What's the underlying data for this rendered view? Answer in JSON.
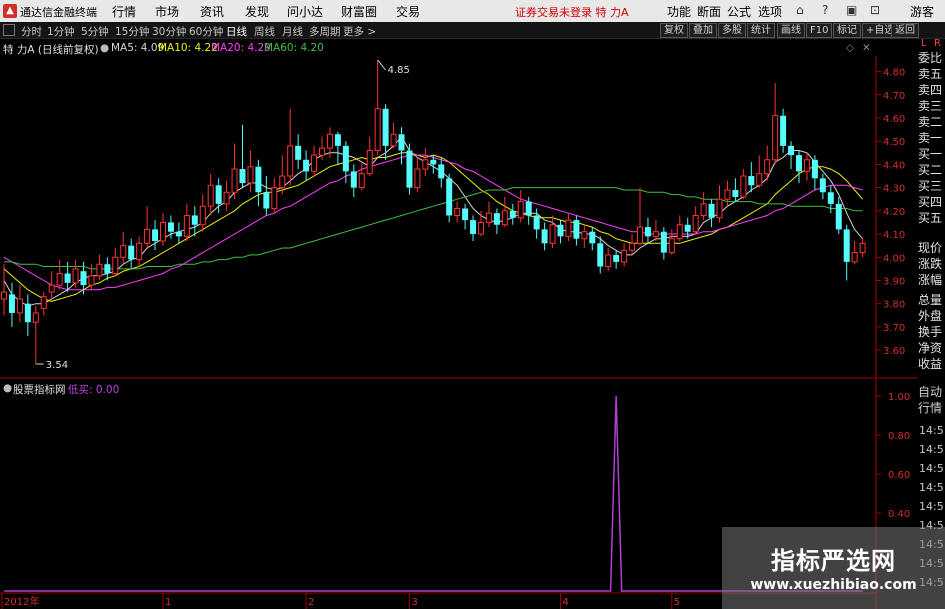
{
  "menubar": {
    "app_title": "通达信金融终端",
    "items": [
      "行情",
      "市场",
      "资讯",
      "发现",
      "问小达",
      "财富圈",
      "交易"
    ],
    "warning": "证券交易未登录  特 力A",
    "right_items": [
      "功能",
      "断面",
      "公式",
      "选项"
    ],
    "window_buttons": [
      "⌂",
      "?",
      "▣",
      "⊡"
    ],
    "guest": "游客"
  },
  "toolbar": {
    "periods": [
      "分时",
      "1分钟",
      "5分钟",
      "15分钟",
      "30分钟",
      "60分钟",
      "日线",
      "周线",
      "月线",
      "多周期",
      "更多 >"
    ],
    "buttons": [
      "复权",
      "叠加",
      "多股",
      "统计",
      "画线",
      "F10",
      "标记",
      "+自选",
      "返回"
    ]
  },
  "kline": {
    "stock": "特 力A (日线前复权)",
    "ma5": "MA5: 4.09",
    "ma10": "MA10: 4.22",
    "ma20": "MA20: 4.29",
    "ma60": "MA60: 4.20",
    "high_label": "4.85",
    "low_label": "3.54",
    "price_ticks": [
      "4.80",
      "4.70",
      "4.60",
      "4.50",
      "4.40",
      "4.30",
      "4.20",
      "4.10",
      "4.00",
      "3.90",
      "3.80",
      "3.70",
      "3.60"
    ]
  },
  "indicator": {
    "source": "股票指标网",
    "label": "低买: 0.00",
    "ticks": [
      "1.00",
      "0.80",
      "0.60",
      "0.40"
    ]
  },
  "time_axis": [
    "2012年",
    "1",
    "2",
    "3",
    "4",
    "5"
  ],
  "sidebar": {
    "top": [
      "L",
      "R"
    ],
    "fields": [
      "委比",
      "卖五",
      "卖四",
      "卖三",
      "卖二",
      "卖一",
      "买一",
      "买二",
      "买三",
      "买四",
      "买五",
      "现价",
      "涨跌",
      "涨幅",
      "总量",
      "外盘",
      "换手",
      "净资",
      "收益",
      "自动",
      "行情"
    ],
    "times": [
      "14:5",
      "14:5",
      "14:5",
      "14:5",
      "14:5",
      "14:5",
      "14:5",
      "14:5",
      "14:5"
    ]
  },
  "watermark": {
    "title": "指标严选网",
    "url": "www.xuezhibiao.com"
  },
  "colors": {
    "up": "#ff3232",
    "down": "#54fcfc",
    "ma5": "#d8d8d8",
    "ma10": "#f0f000",
    "ma20": "#ff40ff",
    "ma60": "#40c040",
    "indicator": "#b040d0"
  },
  "chart_data": {
    "type": "candlestick",
    "y_range": [
      3.54,
      4.85
    ],
    "candles": [
      [
        3.82,
        3.85,
        3.97,
        3.75
      ],
      [
        3.84,
        3.76,
        3.89,
        3.7
      ],
      [
        3.76,
        3.82,
        3.88,
        3.72
      ],
      [
        3.8,
        3.72,
        3.84,
        3.66
      ],
      [
        3.72,
        3.76,
        3.79,
        3.54
      ],
      [
        3.78,
        3.83,
        3.85,
        3.75
      ],
      [
        3.85,
        3.88,
        3.94,
        3.82
      ],
      [
        3.88,
        3.93,
        3.99,
        3.86
      ],
      [
        3.93,
        3.89,
        3.98,
        3.85
      ],
      [
        3.89,
        3.95,
        3.99,
        3.87
      ],
      [
        3.94,
        3.88,
        3.98,
        3.84
      ],
      [
        3.88,
        3.92,
        3.97,
        3.86
      ],
      [
        3.92,
        3.97,
        4.01,
        3.9
      ],
      [
        3.97,
        3.93,
        4.0,
        3.9
      ],
      [
        3.93,
        4.0,
        4.04,
        3.92
      ],
      [
        4.0,
        4.05,
        4.11,
        3.97
      ],
      [
        4.05,
        3.99,
        4.08,
        3.95
      ],
      [
        3.99,
        4.06,
        4.09,
        3.96
      ],
      [
        4.06,
        4.12,
        4.22,
        4.04
      ],
      [
        4.12,
        4.07,
        4.16,
        4.03
      ],
      [
        4.07,
        4.15,
        4.19,
        4.05
      ],
      [
        4.15,
        4.11,
        4.18,
        4.08
      ],
      [
        4.11,
        4.09,
        4.15,
        4.06
      ],
      [
        4.09,
        4.18,
        4.23,
        4.07
      ],
      [
        4.18,
        4.14,
        4.22,
        4.09
      ],
      [
        4.14,
        4.22,
        4.27,
        4.11
      ],
      [
        4.22,
        4.31,
        4.36,
        4.18
      ],
      [
        4.31,
        4.23,
        4.34,
        4.19
      ],
      [
        4.23,
        4.28,
        4.33,
        4.2
      ],
      [
        4.28,
        4.38,
        4.49,
        4.25
      ],
      [
        4.38,
        4.32,
        4.57,
        4.3
      ],
      [
        4.32,
        4.39,
        4.46,
        4.28
      ],
      [
        4.39,
        4.28,
        4.42,
        4.22
      ],
      [
        4.28,
        4.21,
        4.35,
        4.18
      ],
      [
        4.21,
        4.3,
        4.34,
        4.19
      ],
      [
        4.3,
        4.35,
        4.44,
        4.27
      ],
      [
        4.35,
        4.48,
        4.64,
        4.31
      ],
      [
        4.48,
        4.42,
        4.53,
        4.38
      ],
      [
        4.42,
        4.37,
        4.46,
        4.33
      ],
      [
        4.37,
        4.44,
        4.48,
        4.35
      ],
      [
        4.44,
        4.47,
        4.52,
        4.42
      ],
      [
        4.47,
        4.53,
        4.56,
        4.43
      ],
      [
        4.53,
        4.48,
        4.54,
        4.4
      ],
      [
        4.48,
        4.37,
        4.5,
        4.32
      ],
      [
        4.37,
        4.3,
        4.4,
        4.26
      ],
      [
        4.3,
        4.36,
        4.41,
        4.29
      ],
      [
        4.36,
        4.46,
        4.52,
        4.35
      ],
      [
        4.46,
        4.64,
        4.85,
        4.44
      ],
      [
        4.64,
        4.48,
        4.66,
        4.42
      ],
      [
        4.48,
        4.53,
        4.58,
        4.47
      ],
      [
        4.53,
        4.46,
        4.56,
        4.4
      ],
      [
        4.46,
        4.3,
        4.49,
        4.27
      ],
      [
        4.3,
        4.38,
        4.43,
        4.28
      ],
      [
        4.38,
        4.42,
        4.47,
        4.35
      ],
      [
        4.42,
        4.4,
        4.44,
        4.36
      ],
      [
        4.4,
        4.34,
        4.43,
        4.3
      ],
      [
        4.34,
        4.18,
        4.36,
        4.15
      ],
      [
        4.18,
        4.21,
        4.24,
        4.15
      ],
      [
        4.21,
        4.16,
        4.23,
        4.12
      ],
      [
        4.16,
        4.1,
        4.18,
        4.07
      ],
      [
        4.1,
        4.15,
        4.2,
        4.09
      ],
      [
        4.15,
        4.19,
        4.24,
        4.13
      ],
      [
        4.19,
        4.14,
        4.21,
        4.1
      ],
      [
        4.14,
        4.2,
        4.26,
        4.13
      ],
      [
        4.2,
        4.17,
        4.23,
        4.14
      ],
      [
        4.17,
        4.24,
        4.29,
        4.15
      ],
      [
        4.24,
        4.18,
        4.26,
        4.14
      ],
      [
        4.18,
        4.12,
        4.21,
        4.08
      ],
      [
        4.12,
        4.06,
        4.15,
        4.03
      ],
      [
        4.06,
        4.14,
        4.18,
        4.04
      ],
      [
        4.14,
        4.09,
        4.16,
        4.06
      ],
      [
        4.09,
        4.16,
        4.19,
        4.07
      ],
      [
        4.16,
        4.08,
        4.18,
        4.05
      ],
      [
        4.08,
        4.11,
        4.14,
        4.04
      ],
      [
        4.11,
        4.06,
        4.13,
        4.03
      ],
      [
        4.06,
        3.96,
        4.09,
        3.93
      ],
      [
        3.96,
        4.01,
        4.04,
        3.94
      ],
      [
        4.01,
        3.98,
        4.03,
        3.95
      ],
      [
        3.98,
        4.03,
        4.06,
        3.96
      ],
      [
        4.03,
        4.06,
        4.1,
        4.01
      ],
      [
        4.06,
        4.13,
        4.3,
        4.05
      ],
      [
        4.13,
        4.09,
        4.17,
        4.06
      ],
      [
        4.09,
        4.11,
        4.16,
        4.07
      ],
      [
        4.11,
        4.02,
        4.13,
        3.99
      ],
      [
        4.02,
        4.08,
        4.12,
        4.01
      ],
      [
        4.08,
        4.14,
        4.18,
        4.07
      ],
      [
        4.14,
        4.11,
        4.17,
        4.08
      ],
      [
        4.11,
        4.18,
        4.22,
        4.1
      ],
      [
        4.18,
        4.23,
        4.28,
        4.16
      ],
      [
        4.23,
        4.17,
        4.25,
        4.13
      ],
      [
        4.17,
        4.25,
        4.31,
        4.15
      ],
      [
        4.25,
        4.29,
        4.33,
        4.22
      ],
      [
        4.29,
        4.26,
        4.34,
        4.24
      ],
      [
        4.26,
        4.35,
        4.38,
        4.25
      ],
      [
        4.35,
        4.31,
        4.41,
        4.28
      ],
      [
        4.31,
        4.36,
        4.44,
        4.3
      ],
      [
        4.36,
        4.42,
        4.48,
        4.33
      ],
      [
        4.42,
        4.61,
        4.75,
        4.4
      ],
      [
        4.61,
        4.48,
        4.64,
        4.45
      ],
      [
        4.48,
        4.44,
        4.5,
        4.38
      ],
      [
        4.44,
        4.37,
        4.46,
        4.32
      ],
      [
        4.37,
        4.42,
        4.45,
        4.33
      ],
      [
        4.42,
        4.34,
        4.44,
        4.29
      ],
      [
        4.34,
        4.28,
        4.36,
        4.25
      ],
      [
        4.28,
        4.23,
        4.31,
        4.19
      ],
      [
        4.23,
        4.12,
        4.26,
        4.1
      ],
      [
        4.12,
        3.98,
        4.14,
        3.9
      ],
      [
        3.98,
        4.02,
        4.07,
        3.97
      ],
      [
        4.02,
        4.06,
        4.08,
        4.0
      ]
    ],
    "ma_series": [
      {
        "name": "MA5",
        "values": [
          3.9,
          3.84,
          3.81,
          3.79,
          3.8,
          3.8,
          3.82,
          3.84,
          3.86,
          3.89,
          3.91,
          3.92,
          3.92,
          3.93,
          3.94,
          3.97,
          3.99,
          4.0,
          4.04,
          4.06,
          4.08,
          4.1,
          4.11,
          4.12,
          4.13,
          4.15,
          4.19,
          4.22,
          4.24,
          4.28,
          4.3,
          4.32,
          4.32,
          4.3,
          4.29,
          4.3,
          4.33,
          4.36,
          4.38,
          4.42,
          4.44,
          4.45,
          4.45,
          4.44,
          4.43,
          4.41,
          4.39,
          4.43,
          4.45,
          4.48,
          4.52,
          4.46,
          4.43,
          4.41,
          4.39,
          4.37,
          4.34,
          4.31,
          4.26,
          4.21,
          4.18,
          4.16,
          4.15,
          4.16,
          4.17,
          4.19,
          4.19,
          4.19,
          4.16,
          4.15,
          4.12,
          4.11,
          4.11,
          4.1,
          4.1,
          4.08,
          4.05,
          4.03,
          4.01,
          4.01,
          4.04,
          4.06,
          4.08,
          4.08,
          4.09,
          4.09,
          4.09,
          4.1,
          4.15,
          4.17,
          4.19,
          4.22,
          4.24,
          4.26,
          4.29,
          4.31,
          4.34,
          4.41,
          4.43,
          4.46,
          4.46,
          4.45,
          4.41,
          4.37,
          4.33,
          4.27,
          4.19,
          4.12,
          4.08
        ]
      },
      {
        "name": "MA10",
        "values": [
          3.95,
          3.92,
          3.89,
          3.86,
          3.84,
          3.82,
          3.81,
          3.82,
          3.83,
          3.84,
          3.86,
          3.88,
          3.89,
          3.91,
          3.92,
          3.94,
          3.95,
          3.96,
          3.98,
          4.0,
          4.02,
          4.04,
          4.06,
          4.08,
          4.1,
          4.12,
          4.14,
          4.16,
          4.18,
          4.2,
          4.23,
          4.25,
          4.27,
          4.28,
          4.28,
          4.29,
          4.3,
          4.31,
          4.33,
          4.35,
          4.37,
          4.39,
          4.4,
          4.41,
          4.42,
          4.43,
          4.42,
          4.43,
          4.43,
          4.44,
          4.45,
          4.45,
          4.44,
          4.43,
          4.44,
          4.43,
          4.41,
          4.38,
          4.35,
          4.32,
          4.29,
          4.27,
          4.24,
          4.22,
          4.2,
          4.19,
          4.18,
          4.17,
          4.17,
          4.17,
          4.16,
          4.15,
          4.15,
          4.14,
          4.13,
          4.11,
          4.1,
          4.08,
          4.07,
          4.06,
          4.06,
          4.06,
          4.06,
          4.06,
          4.06,
          4.06,
          4.07,
          4.08,
          4.09,
          4.1,
          4.12,
          4.13,
          4.15,
          4.17,
          4.19,
          4.21,
          4.23,
          4.27,
          4.3,
          4.33,
          4.36,
          4.38,
          4.39,
          4.39,
          4.38,
          4.36,
          4.33,
          4.29,
          4.25
        ]
      },
      {
        "name": "MA20",
        "values": [
          4.0,
          3.98,
          3.96,
          3.94,
          3.92,
          3.9,
          3.88,
          3.87,
          3.86,
          3.86,
          3.86,
          3.86,
          3.86,
          3.87,
          3.87,
          3.88,
          3.89,
          3.9,
          3.91,
          3.92,
          3.93,
          3.95,
          3.96,
          3.98,
          4.0,
          4.02,
          4.04,
          4.06,
          4.08,
          4.1,
          4.12,
          4.14,
          4.16,
          4.18,
          4.19,
          4.21,
          4.22,
          4.24,
          4.26,
          4.28,
          4.3,
          4.32,
          4.33,
          4.35,
          4.36,
          4.38,
          4.39,
          4.4,
          4.41,
          4.42,
          4.43,
          4.44,
          4.44,
          4.44,
          4.43,
          4.42,
          4.41,
          4.4,
          4.38,
          4.37,
          4.35,
          4.33,
          4.31,
          4.29,
          4.27,
          4.25,
          4.24,
          4.23,
          4.22,
          4.21,
          4.2,
          4.19,
          4.18,
          4.17,
          4.16,
          4.15,
          4.14,
          4.13,
          4.12,
          4.11,
          4.11,
          4.1,
          4.1,
          4.1,
          4.1,
          4.1,
          4.1,
          4.1,
          4.11,
          4.11,
          4.12,
          4.13,
          4.14,
          4.15,
          4.16,
          4.17,
          4.18,
          4.2,
          4.21,
          4.23,
          4.25,
          4.27,
          4.29,
          4.3,
          4.31,
          4.31,
          4.31,
          4.3,
          4.29
        ]
      },
      {
        "name": "MA60",
        "values": [
          3.98,
          3.98,
          3.97,
          3.97,
          3.97,
          3.96,
          3.96,
          3.96,
          3.96,
          3.96,
          3.96,
          3.95,
          3.95,
          3.95,
          3.95,
          3.95,
          3.95,
          3.95,
          3.96,
          3.96,
          3.96,
          3.96,
          3.97,
          3.97,
          3.97,
          3.98,
          3.98,
          3.99,
          3.99,
          4.0,
          4.0,
          4.01,
          4.01,
          4.02,
          4.03,
          4.04,
          4.04,
          4.05,
          4.06,
          4.07,
          4.08,
          4.09,
          4.1,
          4.11,
          4.12,
          4.13,
          4.14,
          4.15,
          4.16,
          4.17,
          4.18,
          4.19,
          4.2,
          4.21,
          4.22,
          4.23,
          4.24,
          4.25,
          4.26,
          4.27,
          4.28,
          4.29,
          4.29,
          4.29,
          4.3,
          4.3,
          4.3,
          4.3,
          4.3,
          4.3,
          4.3,
          4.3,
          4.3,
          4.3,
          4.3,
          4.3,
          4.3,
          4.3,
          4.29,
          4.29,
          4.29,
          4.28,
          4.28,
          4.28,
          4.27,
          4.27,
          4.26,
          4.26,
          4.25,
          4.25,
          4.25,
          4.24,
          4.24,
          4.24,
          4.24,
          4.23,
          4.23,
          4.23,
          4.23,
          4.22,
          4.22,
          4.22,
          4.22,
          4.22,
          4.21,
          4.21,
          4.21,
          4.2,
          4.2
        ]
      }
    ],
    "indicator_values": {
      "spike_index": 77,
      "spike_value": 1.0,
      "baseline": 0.0
    }
  }
}
